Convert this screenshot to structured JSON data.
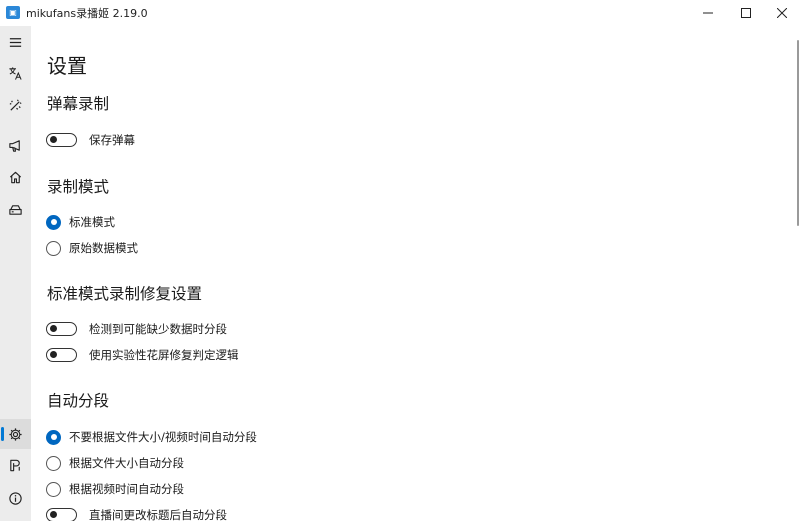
{
  "window": {
    "title": "mikufans录播姬 2.19.0",
    "icon": "app-logo-icon",
    "controls": [
      "minimize-icon",
      "maximize-icon",
      "close-icon"
    ]
  },
  "sidebar": {
    "items": [
      {
        "name": "menu",
        "icon": "hamburger-menu-icon"
      },
      {
        "name": "language",
        "icon": "translate-icon"
      },
      {
        "name": "tools",
        "icon": "magic-wand-icon"
      },
      {
        "name": "announcement",
        "icon": "megaphone-icon"
      },
      {
        "name": "home",
        "icon": "home-icon"
      },
      {
        "name": "tasks",
        "icon": "drive-icon"
      },
      {
        "name": "settings",
        "icon": "gear-icon",
        "selected": true
      },
      {
        "name": "toolbox",
        "icon": "toolbox-icon"
      },
      {
        "name": "about",
        "icon": "info-icon"
      }
    ]
  },
  "page": {
    "title": "设置",
    "danmaku": {
      "title": "弹幕录制",
      "save_danmaku": {
        "label": "保存弹幕",
        "on": false
      }
    },
    "record_mode": {
      "title": "录制模式",
      "options": [
        {
          "label": "标准模式",
          "checked": true
        },
        {
          "label": "原始数据模式",
          "checked": false
        }
      ]
    },
    "repair": {
      "title": "标准模式录制修复设置",
      "toggles": [
        {
          "label": "检测到可能缺少数据时分段",
          "on": false
        },
        {
          "label": "使用实验性花屏修复判定逻辑",
          "on": false
        }
      ]
    },
    "auto_split": {
      "title": "自动分段",
      "options": [
        {
          "label": "不要根据文件大小/视频时间自动分段",
          "checked": true
        },
        {
          "label": "根据文件大小自动分段",
          "checked": false
        },
        {
          "label": "根据视频时间自动分段",
          "checked": false
        }
      ],
      "title_change_toggle": {
        "label": "直播间更改标题后自动分段",
        "on": false
      }
    }
  },
  "colors": {
    "accent": "#0067c0",
    "sidebar_bg": "#ececec",
    "selected_bg": "#dcdcdc"
  }
}
